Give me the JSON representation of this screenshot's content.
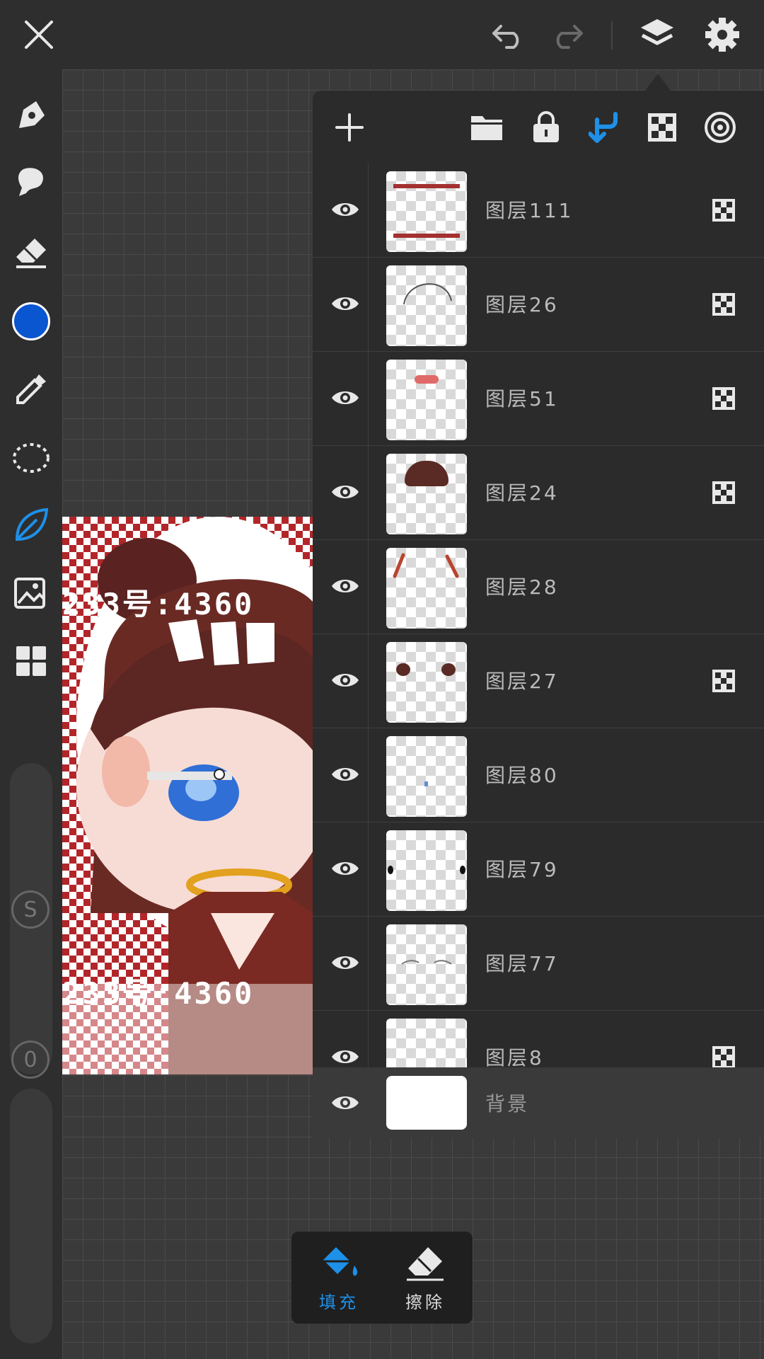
{
  "layers_panel": {
    "header_icons": [
      "add-icon",
      "folder-icon",
      "lock-icon",
      "clip-arrow-icon",
      "alpha-lock-icon",
      "reference-icon"
    ],
    "layers": [
      {
        "name": "图层111",
        "visible": true,
        "alpha_lock": true
      },
      {
        "name": "图层26",
        "visible": true,
        "alpha_lock": true
      },
      {
        "name": "图层51",
        "visible": true,
        "alpha_lock": true
      },
      {
        "name": "图层24",
        "visible": true,
        "alpha_lock": true
      },
      {
        "name": "图层28",
        "visible": true,
        "alpha_lock": false
      },
      {
        "name": "图层27",
        "visible": true,
        "alpha_lock": true
      },
      {
        "name": "图层80",
        "visible": true,
        "alpha_lock": false
      },
      {
        "name": "图层79",
        "visible": true,
        "alpha_lock": false
      },
      {
        "name": "图层77",
        "visible": true,
        "alpha_lock": false
      },
      {
        "name": "图层8",
        "visible": true,
        "alpha_lock": true
      }
    ],
    "background_layer": {
      "name": "背景",
      "visible": true
    }
  },
  "bottom_actions": {
    "fill_label": "填充",
    "erase_label": "擦除"
  },
  "left_toolbar": {
    "brush_size": "S",
    "opacity": "0",
    "current_color": "#0a55d0"
  },
  "artwork": {
    "watermark_text": "233号:4360"
  },
  "colors": {
    "accent": "#1e90e8",
    "panel": "#2b2b2b",
    "toolbar": "#2e2e2e"
  }
}
